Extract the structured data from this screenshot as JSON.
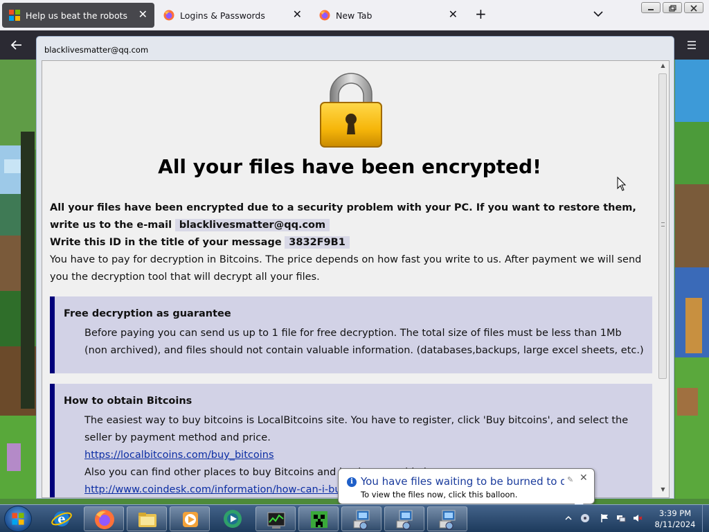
{
  "browser": {
    "tabs": [
      {
        "label": "Help us beat the robots",
        "icon": "windows-logo-icon",
        "active": true
      },
      {
        "label": "Logins & Passwords",
        "icon": "firefox-icon",
        "active": false
      },
      {
        "label": "New Tab",
        "icon": "firefox-icon",
        "active": false
      }
    ],
    "new_tab_icon": "plus-icon",
    "tab_list_icon": "chevron-down-icon"
  },
  "ransom_window": {
    "title": "blacklivesmatter@qq.com",
    "icon": "padlock-icon",
    "headline": "All your files have been encrypted!",
    "intro_bold": "All your files have been encrypted due to a security problem with your PC. If you want to restore them, write us to the e-mail",
    "email": "blacklivesmatter@qq.com",
    "id_label": "Write this ID in the title of your message",
    "id_value": "3832F9B1",
    "payment_text": "You have to pay for decryption in Bitcoins. The price depends on how fast you write to us. After payment we will send you the decryption tool that will decrypt all your files.",
    "guarantee": {
      "heading": "Free decryption as guarantee",
      "text": "Before paying you can send us up to 1 file for free decryption. The total size of files must be less than 1Mb (non archived), and files should not contain valuable information. (databases,backups, large excel sheets, etc.)"
    },
    "bitcoins": {
      "heading": "How to obtain Bitcoins",
      "text": "The easiest way to buy bitcoins is LocalBitcoins site. You have to register, click 'Buy bitcoins', and select the seller by payment method and price.",
      "link1": "https://localbitcoins.com/buy_bitcoins",
      "text2": "Also you can find other places to buy Bitcoins and beginners guide here:",
      "link2": "http://www.coindesk.com/information/how-can-i-buy-bitcoins/"
    }
  },
  "balloon": {
    "title": "You have files waiting to be burned to disc",
    "text": "To view the files now, click this balloon.",
    "icon": "info-icon"
  },
  "taskbar": {
    "pinned": [
      "internet-explorer-icon",
      "firefox-icon",
      "file-explorer-icon",
      "media-player-icon",
      "media-center-icon",
      "task-manager-icon",
      "minecraft-creeper-icon",
      "network-computer-icon",
      "network-computer-icon",
      "network-computer-icon"
    ],
    "clock_time": "3:39 PM",
    "clock_date": "8/11/2024"
  }
}
